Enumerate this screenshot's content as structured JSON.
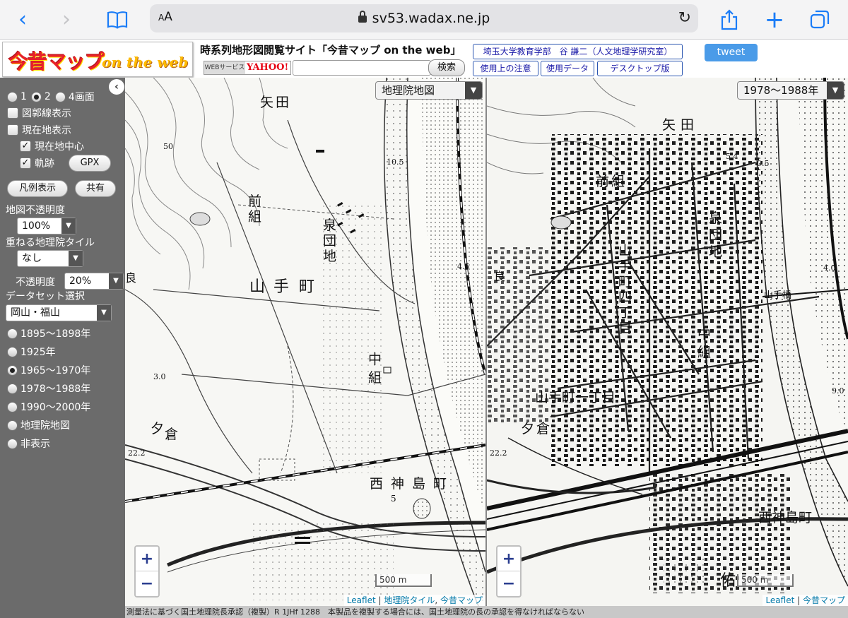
{
  "browser": {
    "url": "sv53.wadax.ne.jp",
    "text_size_button": "AA"
  },
  "header": {
    "logo_main": "今昔マップ",
    "logo_sub": "on the web",
    "site_title": "時系列地形図閲覧サイト「今昔マップ on the web」",
    "yahoo_label_ws": "WEBサービス",
    "yahoo_label": "YAHOO!",
    "search_value": "",
    "search_button": "検索",
    "affiliation": "埼玉大学教育学部　谷 謙二（人文地理学研究室）",
    "links": [
      "使用上の注意",
      "使用データ",
      "デスクトップ版"
    ],
    "tweet": "tweet"
  },
  "sidebar": {
    "screen_options": [
      "1",
      "2",
      "4画面"
    ],
    "screen_selected": "2",
    "checkbox_grid": "図郭線表示",
    "checkbox_location": "現在地表示",
    "checkbox_center": "現在地中心",
    "checkbox_track": "軌跡",
    "gpx_button": "GPX",
    "legend_button": "凡例表示",
    "share_button": "共有",
    "opacity_label": "地図不透明度",
    "opacity_value": "100%",
    "overlay_label": "重ねる地理院タイル",
    "overlay_value": "なし",
    "overlay_opacity_label": "不透明度",
    "overlay_opacity_value": "20%",
    "dataset_label": "データセット選択",
    "dataset_value": "岡山・福山",
    "periods": [
      "1895～1898年",
      "1925年",
      "1965～1970年",
      "1978～1988年",
      "1990～2000年",
      "地理院地図",
      "非表示"
    ],
    "period_selected": "1965～1970年"
  },
  "map_left": {
    "layer_select": "地理院地図",
    "labels": [
      "矢",
      "田",
      "前",
      "組",
      "泉",
      "団",
      "地",
      "山",
      "手",
      "町",
      "中",
      "組",
      "夕",
      "倉",
      "西",
      "神",
      "島",
      "町",
      "良",
      "5",
      "50",
      "4.5",
      "22.2",
      "10.5",
      "3.0"
    ],
    "scale": "500 m",
    "attribution_leaflet": "Leaflet",
    "attribution_tile": "地理院タイル",
    "attribution_konjaku": "今昔マップ"
  },
  "map_right": {
    "layer_select": "1978～1988年",
    "labels": [
      "矢",
      "田",
      "前",
      "組",
      "泉",
      "団",
      "地",
      "山",
      "手",
      "町",
      "四",
      "丁",
      "目",
      "中",
      "組",
      "山手町一丁目",
      "夕",
      "倉",
      "西神島町",
      "良",
      "山手橋",
      "佑",
      "5.4",
      "0.5",
      "4.0",
      "22.2",
      "9.0"
    ],
    "scale": "500 m",
    "attribution_leaflet": "Leaflet",
    "attribution_konjaku": "今昔マップ"
  },
  "footer": "測量法に基づく国土地理院長承認（複製）R 1JHf 1288　本製品を複製する場合には、国土地理院の長の承認を得なければならない",
  "colors": {
    "sidebar_bg": "#6b6b6b",
    "accent_blue": "#1a7cf7",
    "tweet_blue": "#4a9be8"
  }
}
